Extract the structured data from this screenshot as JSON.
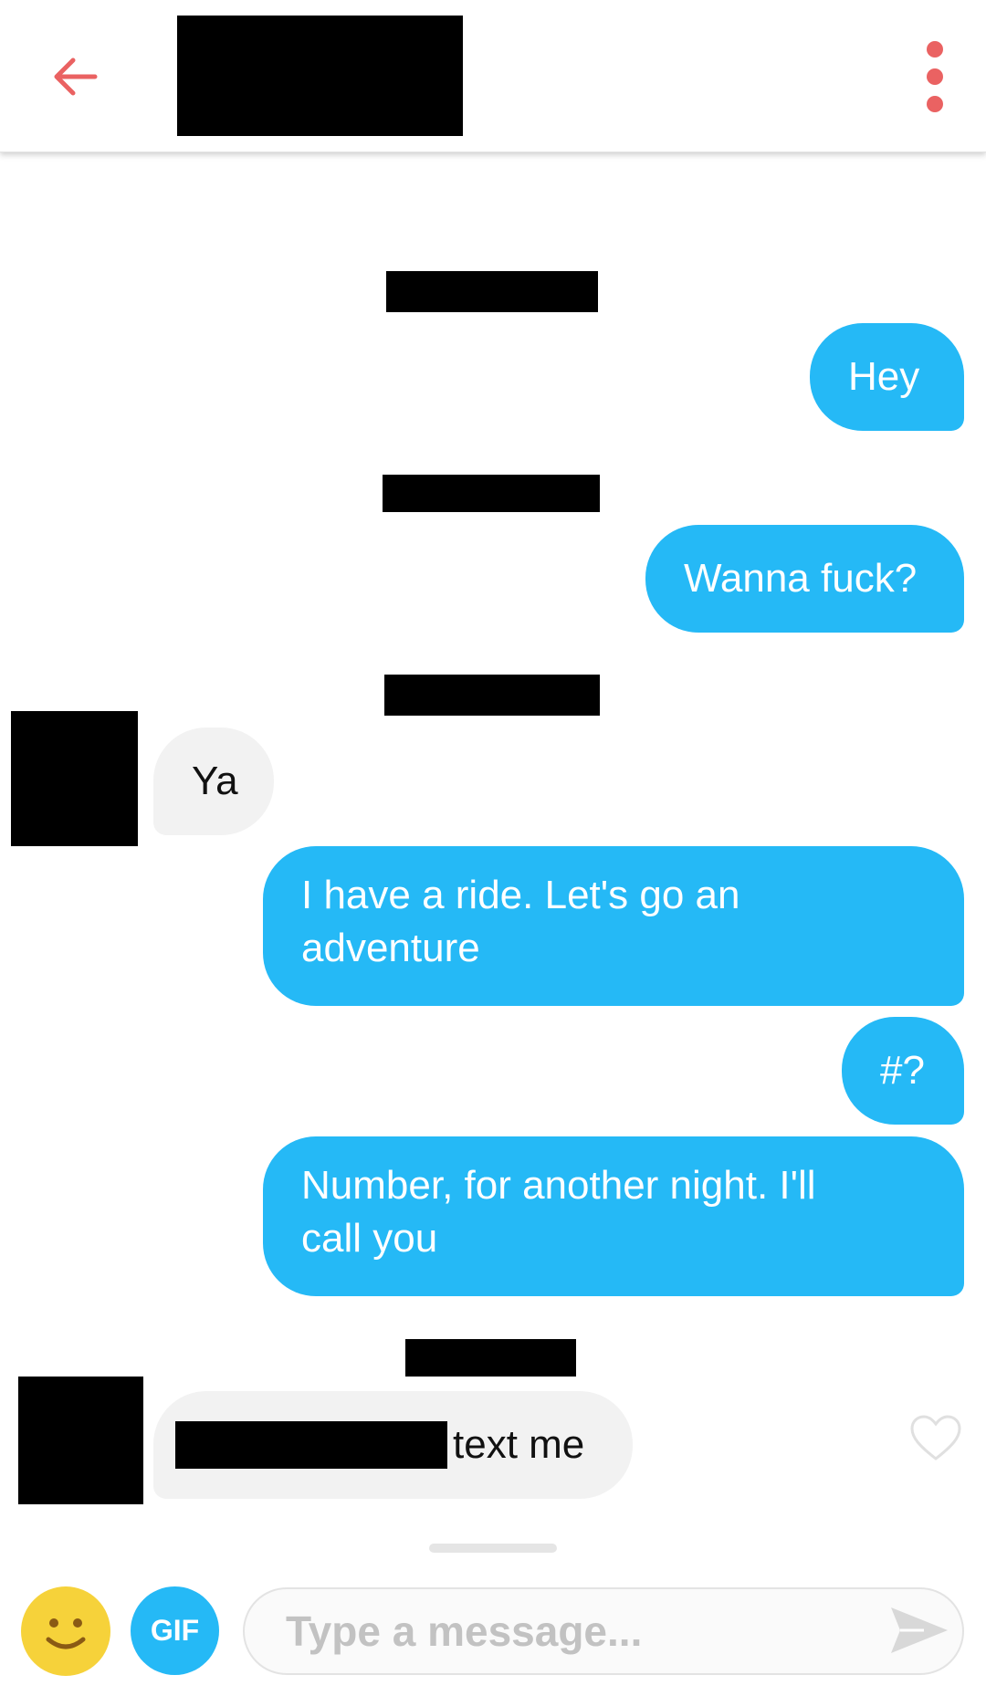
{
  "header": {
    "back_icon": "arrow-left-icon",
    "more_icon": "more-vertical-icon",
    "accent_color": "#ea6262"
  },
  "messages": [
    {
      "direction": "outgoing",
      "text": "Hey"
    },
    {
      "direction": "outgoing",
      "text": "Wanna fuck?"
    },
    {
      "direction": "incoming",
      "text": "Ya"
    },
    {
      "direction": "outgoing",
      "text": "I have a ride. Let's go an adventure"
    },
    {
      "direction": "outgoing",
      "text": "#?"
    },
    {
      "direction": "outgoing",
      "text": "Number, for another night. I'll call you"
    },
    {
      "direction": "incoming",
      "text": "text me",
      "liked": false
    }
  ],
  "composer": {
    "gif_label": "GIF",
    "placeholder": "Type a message...",
    "emoji_icon": "smiley-icon",
    "send_icon": "send-icon"
  },
  "colors": {
    "outgoing_bubble": "#25b9f6",
    "incoming_bubble": "#f2f2f2",
    "emoji": "#f6d23a",
    "gif": "#25b9f6"
  }
}
